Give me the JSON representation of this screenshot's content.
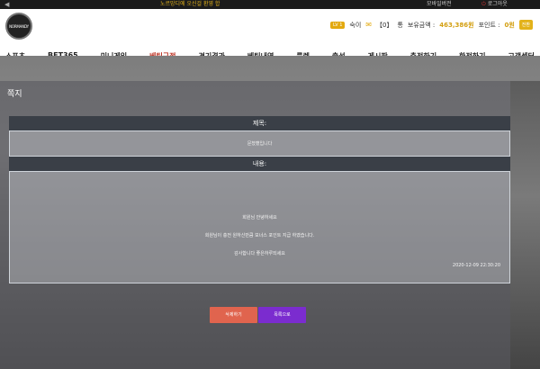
{
  "topbar": {
    "notice": "노르망디에 오신걸 환영 합",
    "mobile": "모바일버전",
    "logout": "로그아웃"
  },
  "header": {
    "logo_text": "NORMANDY",
    "level": "LV 1",
    "user_name": "숙이",
    "message_count": "【0】",
    "message_unit": "통",
    "balance_label": "보유금액 :",
    "balance_value": "463,386원",
    "points_label": "포인트 :",
    "points_value": "0원",
    "convert_label": "전환"
  },
  "nav": [
    "스포츠",
    "BET365",
    "미니게임",
    "베팅규정",
    "경기결과",
    "베팅내역",
    "룰렛",
    "출석",
    "게시판",
    "충전하기",
    "환전하기",
    "고객센터"
  ],
  "active_nav": "베팅규정",
  "message": {
    "page_title": "쪽지",
    "subject_label": "제목:",
    "subject_value": "문쳤헀입니다",
    "content_label": "내용:",
    "content_lines": [
      "회원님 안녕하세요",
      "회원님이 충전 원하신만큼 보너스 포인트 지급 하였습니다.",
      "감사합니다 좋은하루되세요"
    ],
    "date": "2020-12-09 22:30:20"
  },
  "buttons": {
    "delete": "삭제하기",
    "list": "목록으로"
  },
  "colors": {
    "accent": "#e3b21a",
    "active_nav": "#c0392b",
    "delete_button": "#e0644e",
    "list_button": "#7b2ccf"
  }
}
